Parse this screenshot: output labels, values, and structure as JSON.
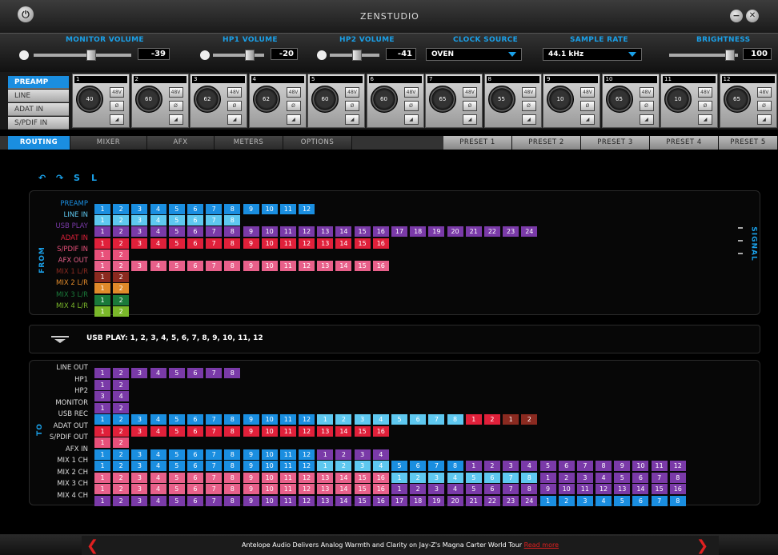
{
  "app": {
    "logo": "ZENSTUDIO"
  },
  "controls": {
    "monitor_volume": {
      "label": "MONITOR VOLUME",
      "value": "-39"
    },
    "hp1_volume": {
      "label": "HP1 VOLUME",
      "value": "-20"
    },
    "hp2_volume": {
      "label": "HP2 VOLUME",
      "value": "-41"
    },
    "clock_source": {
      "label": "CLOCK SOURCE",
      "value": "OVEN"
    },
    "sample_rate": {
      "label": "SAMPLE RATE",
      "value": "44.1 kHz"
    },
    "brightness": {
      "label": "BRIGHTNESS",
      "value": "100"
    }
  },
  "input_sources": [
    "PREAMP",
    "LINE",
    "ADAT IN",
    "S/PDIF IN"
  ],
  "channels": [
    {
      "num": "1",
      "gain": "40"
    },
    {
      "num": "2",
      "gain": "60"
    },
    {
      "num": "3",
      "gain": "62"
    },
    {
      "num": "4",
      "gain": "62"
    },
    {
      "num": "5",
      "gain": "60"
    },
    {
      "num": "6",
      "gain": "60"
    },
    {
      "num": "7",
      "gain": "65"
    },
    {
      "num": "8",
      "gain": "55"
    },
    {
      "num": "9",
      "gain": "10"
    },
    {
      "num": "10",
      "gain": "65"
    },
    {
      "num": "11",
      "gain": "10"
    },
    {
      "num": "12",
      "gain": "65"
    }
  ],
  "phantom_label": "48V",
  "tabs": [
    "ROUTING",
    "MIXER",
    "AFX",
    "METERS",
    "OPTIONS"
  ],
  "presets": [
    "PRESET 1",
    "PRESET 2",
    "PRESET 3",
    "PRESET 4",
    "PRESET 5"
  ],
  "routing": {
    "from_label": "FROM",
    "signal_label": "SIGNAL",
    "to_label": "TO",
    "from_rows": [
      {
        "label": "PREAMP",
        "color": "#1a8ee0",
        "count": 12
      },
      {
        "label": "LINE IN",
        "color": "#5ec8f0",
        "count": 8
      },
      {
        "label": "USB PLAY",
        "color": "#7a3aa8",
        "count": 24
      },
      {
        "label": "ADAT IN",
        "color": "#e0203a",
        "count": 16
      },
      {
        "label": "S/PDIF IN",
        "color": "#e8507a",
        "count": 2
      },
      {
        "label": "AFX OUT",
        "color": "#e8608a",
        "count": 16
      },
      {
        "label": "MIX 1 L/R",
        "color": "#8a2a20",
        "count": 2
      },
      {
        "label": "MIX 2 L/R",
        "color": "#e08a2a",
        "count": 2
      },
      {
        "label": "MIX 3 L/R",
        "color": "#1a7a3a",
        "count": 2
      },
      {
        "label": "MIX 4 L/R",
        "color": "#7ab82a",
        "count": 2
      }
    ],
    "info_text": "USB PLAY: 1, 2, 3, 4, 5, 6, 7, 8, 9, 10, 11, 12",
    "to_rows": [
      {
        "label": "LINE OUT",
        "cells": [
          "1",
          "2",
          "3",
          "4",
          "5",
          "6",
          "7",
          "8"
        ],
        "colors": [
          "#7a3aa8"
        ]
      },
      {
        "label": "HP1",
        "cells": [
          "1",
          "2"
        ],
        "colors": [
          "#7a3aa8"
        ]
      },
      {
        "label": "HP2",
        "cells": [
          "3",
          "4"
        ],
        "colors": [
          "#7a3aa8"
        ]
      },
      {
        "label": "MONITOR",
        "cells": [
          "1",
          "2"
        ],
        "colors": [
          "#7a3aa8"
        ]
      },
      {
        "label": "USB REC",
        "cells": [
          "1",
          "2",
          "3",
          "4",
          "5",
          "6",
          "7",
          "8",
          "9",
          "10",
          "11",
          "12",
          "1",
          "2",
          "3",
          "4",
          "5",
          "6",
          "7",
          "8",
          "1",
          "2",
          "1",
          "2"
        ],
        "colors": [
          "#1a8ee0x12",
          "#5ec8f0x8",
          "#e0203ax2",
          "#8a2a20x2"
        ]
      },
      {
        "label": "ADAT OUT",
        "cells": [
          "1",
          "2",
          "3",
          "4",
          "5",
          "6",
          "7",
          "8",
          "9",
          "10",
          "11",
          "12",
          "13",
          "14",
          "15",
          "16"
        ],
        "colors": [
          "#e0203a"
        ]
      },
      {
        "label": "S/PDIF OUT",
        "cells": [
          "1",
          "2"
        ],
        "colors": [
          "#e8507a"
        ]
      },
      {
        "label": "AFX IN",
        "cells": [
          "1",
          "2",
          "3",
          "4",
          "5",
          "6",
          "7",
          "8",
          "9",
          "10",
          "11",
          "12",
          "1",
          "2",
          "3",
          "4"
        ],
        "colors": [
          "#1a8ee0x12",
          "#7a3aa8x4"
        ]
      },
      {
        "label": "MIX 1 CH",
        "cells": [
          "1",
          "2",
          "3",
          "4",
          "5",
          "6",
          "7",
          "8",
          "9",
          "10",
          "11",
          "12",
          "1",
          "2",
          "3",
          "4",
          "5",
          "6",
          "7",
          "8",
          "1",
          "2",
          "3",
          "4",
          "5",
          "6",
          "7",
          "8",
          "9",
          "10",
          "11",
          "12"
        ],
        "colors": [
          "#1a8ee0x12",
          "#5ec8f0x4",
          "#1a8ee0x4",
          "#7a3aa8x12"
        ]
      },
      {
        "label": "MIX 2 CH",
        "cells": [
          "1",
          "2",
          "3",
          "4",
          "5",
          "6",
          "7",
          "8",
          "9",
          "10",
          "11",
          "12",
          "13",
          "14",
          "15",
          "16",
          "1",
          "2",
          "3",
          "4",
          "5",
          "6",
          "7",
          "8",
          "1",
          "2",
          "3",
          "4",
          "5",
          "6",
          "7",
          "8"
        ],
        "colors": [
          "#e8608ax16",
          "#5ec8f0x8",
          "#7a3aa8x8"
        ]
      },
      {
        "label": "MIX 3 CH",
        "cells": [
          "1",
          "2",
          "3",
          "4",
          "5",
          "6",
          "7",
          "8",
          "9",
          "10",
          "11",
          "12",
          "13",
          "14",
          "15",
          "16",
          "1",
          "2",
          "3",
          "4",
          "5",
          "6",
          "7",
          "8",
          "9",
          "10",
          "11",
          "12",
          "13",
          "14",
          "15",
          "16"
        ],
        "colors": [
          "#e8608ax16",
          "#7a3aa8x16"
        ]
      },
      {
        "label": "MIX 4 CH",
        "cells": [
          "1",
          "2",
          "3",
          "4",
          "5",
          "6",
          "7",
          "8",
          "9",
          "10",
          "11",
          "12",
          "13",
          "14",
          "15",
          "16",
          "17",
          "18",
          "19",
          "20",
          "21",
          "22",
          "23",
          "24",
          "1",
          "2",
          "3",
          "4",
          "5",
          "6",
          "7",
          "8"
        ],
        "colors": [
          "#7a3aa8x24",
          "#1a8ee0x8"
        ]
      }
    ]
  },
  "news": {
    "text": "Antelope Audio Delivers Analog Warmth and Clarity on Jay-Z's Magna Carter World Tour",
    "link": "Read more"
  }
}
